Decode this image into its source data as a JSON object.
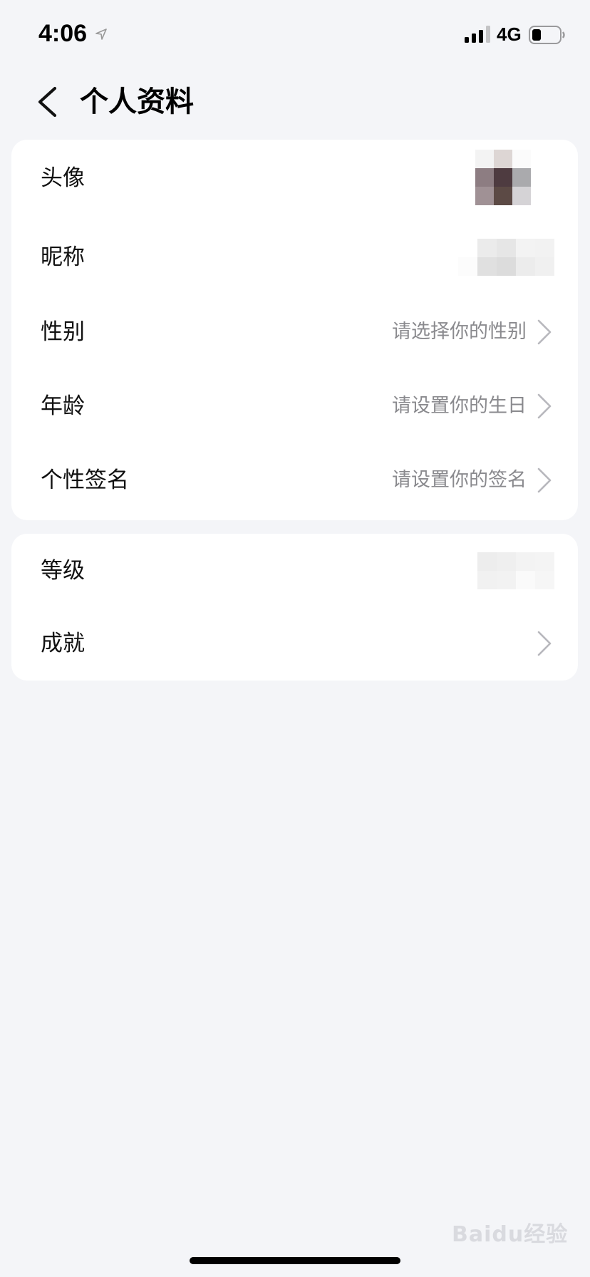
{
  "status_bar": {
    "time": "4:06",
    "network": "4G"
  },
  "nav": {
    "title": "个人资料"
  },
  "profile_card": {
    "rows": [
      {
        "label": "头像",
        "value": ""
      },
      {
        "label": "昵称",
        "value": ""
      },
      {
        "label": "性别",
        "value": "请选择你的性别"
      },
      {
        "label": "年龄",
        "value": "请设置你的生日"
      },
      {
        "label": "个性签名",
        "value": "请设置你的签名"
      }
    ]
  },
  "level_card": {
    "rows": [
      {
        "label": "等级",
        "value": ""
      },
      {
        "label": "成就",
        "value": ""
      }
    ]
  },
  "watermark": "Baidu经验",
  "colors": {
    "background": "#f4f5f8",
    "card": "#ffffff",
    "placeholder_text": "#8a8a8e",
    "chevron": "#b8b8bd"
  }
}
